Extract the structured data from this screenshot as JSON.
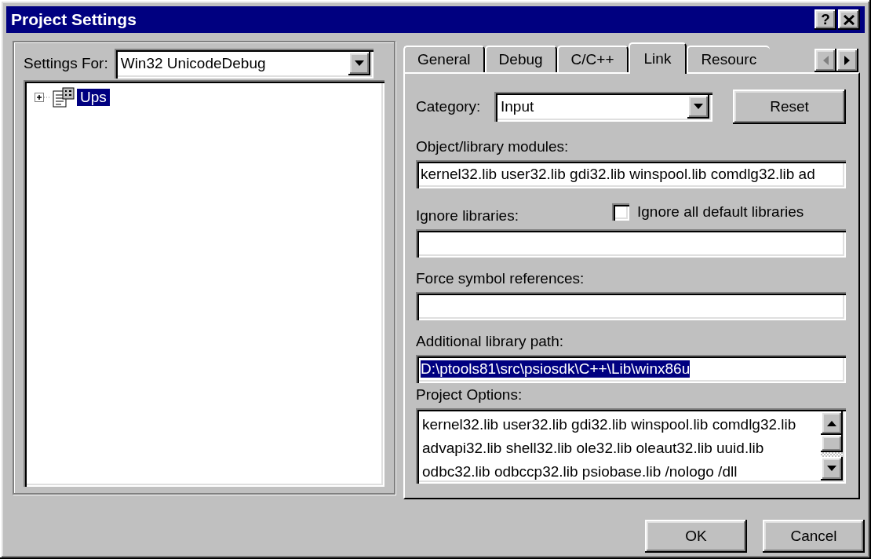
{
  "window": {
    "title": "Project Settings",
    "help_button": "?"
  },
  "settings_for": {
    "label": "Settings For:",
    "value": "Win32 UnicodeDebug"
  },
  "tree": [
    {
      "label": "Ups",
      "selected": true,
      "expanded": false
    }
  ],
  "tabs": [
    {
      "label": "General",
      "selected": false
    },
    {
      "label": "Debug",
      "selected": false
    },
    {
      "label": "C/C++",
      "selected": false
    },
    {
      "label": "Link",
      "selected": true
    },
    {
      "label": "Resourc",
      "selected": false
    }
  ],
  "category": {
    "label": "Category:",
    "value": "Input"
  },
  "reset_button": "Reset",
  "object_modules": {
    "label": "Object/library modules:",
    "value": "kernel32.lib user32.lib gdi32.lib winspool.lib comdlg32.lib ad"
  },
  "ignore_libraries": {
    "label": "Ignore libraries:"
  },
  "ignore_all_default": {
    "label": "Ignore all default libraries",
    "checked": false
  },
  "force_symbol": {
    "label": "Force symbol references:"
  },
  "additional_path": {
    "label": "Additional library path:",
    "value": "D:\\ptools81\\src\\psiosdk\\C++\\Lib\\winx86u",
    "selected": true
  },
  "project_options": {
    "label": "Project Options:",
    "lines": [
      "kernel32.lib user32.lib gdi32.lib winspool.lib comdlg32.lib",
      "advapi32.lib shell32.lib ole32.lib oleaut32.lib uuid.lib",
      "odbc32.lib odbccp32.lib psiobase.lib /nologo /dll"
    ]
  },
  "buttons": [
    "OK",
    "Cancel"
  ]
}
